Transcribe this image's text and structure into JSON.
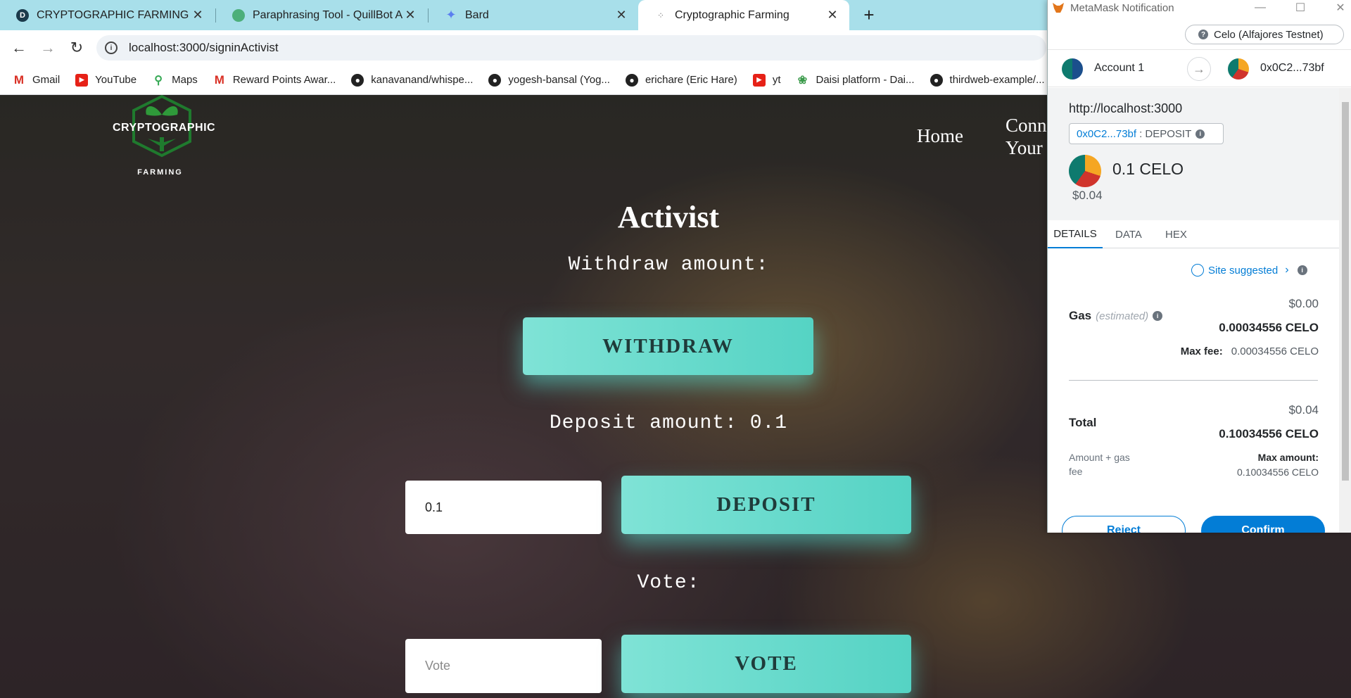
{
  "tabs": [
    {
      "title": "CRYPTOGRAPHIC FARMING | Dev",
      "favicon": "devpost-icon"
    },
    {
      "title": "Paraphrasing Tool - QuillBot AI",
      "favicon": "quillbot-icon"
    },
    {
      "title": "Bard",
      "favicon": "bard-sparkle-icon"
    },
    {
      "title": "Cryptographic Farming",
      "favicon": "loading-icon",
      "active": true
    }
  ],
  "address": {
    "url": "localhost:3000/signinActivist"
  },
  "bookmarks": [
    {
      "label": "Gmail",
      "icon": "gmail-icon"
    },
    {
      "label": "YouTube",
      "icon": "youtube-icon"
    },
    {
      "label": "Maps",
      "icon": "maps-pin-icon"
    },
    {
      "label": "Reward Points Awar...",
      "icon": "gmail-icon"
    },
    {
      "label": "kanavanand/whispe...",
      "icon": "github-icon"
    },
    {
      "label": "yogesh-bansal (Yog...",
      "icon": "github-icon"
    },
    {
      "label": "erichare (Eric Hare)",
      "icon": "github-icon"
    },
    {
      "label": "yt",
      "icon": "youtube-icon"
    },
    {
      "label": "Daisi platform - Dai...",
      "icon": "daisi-icon"
    },
    {
      "label": "thirdweb-example/...",
      "icon": "github-icon"
    }
  ],
  "site": {
    "logo_word": "CRYPTOGRAPHIC",
    "logo_sub": "FARMING",
    "nav": {
      "home": "Home",
      "connect_1": "Conn",
      "connect_2": "Your"
    },
    "heading": "Activist",
    "withdraw_label": "Withdraw amount:",
    "withdraw_button": "WITHDRAW",
    "deposit_label": "Deposit amount: 0.1",
    "deposit_value": "0.1",
    "deposit_button": "DEPOSIT",
    "vote_label": "Vote:",
    "vote_placeholder": "Vote",
    "vote_button": "VOTE"
  },
  "metamask": {
    "window_title": "MetaMask Notification",
    "network": "Celo (Alfajores Testnet)",
    "from_account": "Account 1",
    "to_address": "0x0C2...73bf",
    "origin": "http://localhost:3000",
    "fn_address": "0x0C2...73bf",
    "fn_name": ": DEPOSIT",
    "amount": "0.1 CELO",
    "amount_fiat": "$0.04",
    "tabs": [
      "DETAILS",
      "DATA",
      "HEX"
    ],
    "active_tab": "DETAILS",
    "site_suggested": "Site suggested",
    "gas_label": "Gas",
    "gas_estimated": "(estimated)",
    "gas_fiat": "$0.00",
    "gas_celo": "0.00034556 CELO",
    "max_fee_label": "Max fee:",
    "max_fee_value": "0.00034556 CELO",
    "total_fiat": "$0.04",
    "total_label": "Total",
    "total_celo": "0.10034556 CELO",
    "amount_gas_label_1": "Amount + gas",
    "amount_gas_label_2": "fee",
    "max_amount_label": "Max amount:",
    "max_amount_value": "0.10034556 CELO",
    "reject_button": "Reject",
    "confirm_button": "Confirm"
  },
  "colors": {
    "tabbar": "#a8dfea",
    "accent_button": "#5fd8c9",
    "metamask_blue": "#037dd6"
  }
}
